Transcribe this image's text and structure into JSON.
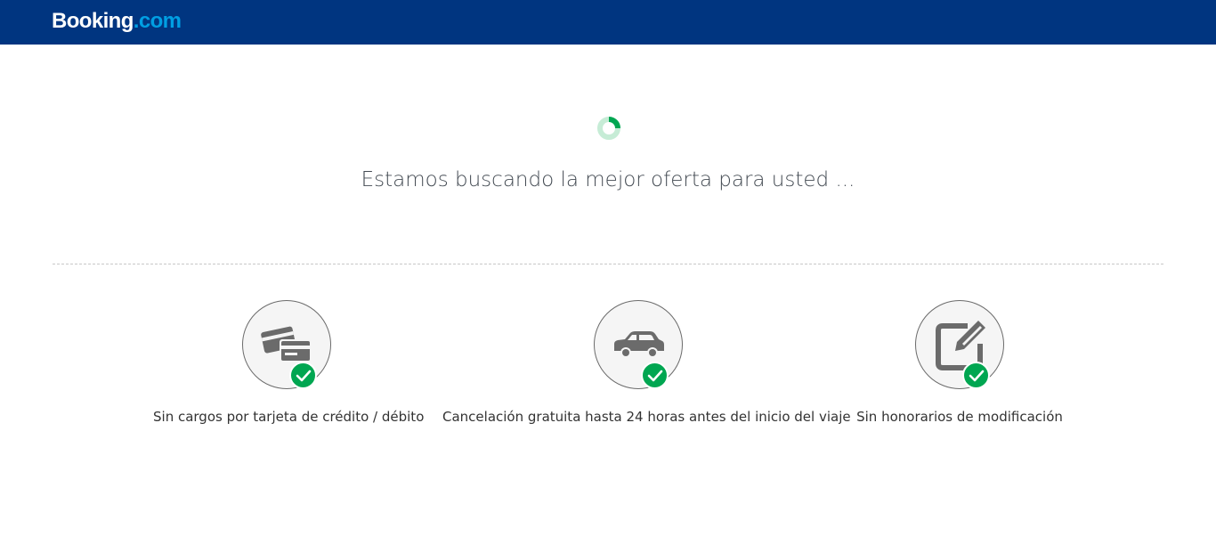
{
  "header": {
    "logo_main": "Booking",
    "logo_tld": ".com"
  },
  "loading": {
    "message": "Estamos buscando la mejor oferta para usted ..."
  },
  "features": [
    {
      "label": "Sin cargos por tarjeta de crédito / débito",
      "icon": "credit-cards-icon"
    },
    {
      "label": "Cancelación gratuita hasta 24 horas antes del inicio del viaje",
      "icon": "car-icon"
    },
    {
      "label": "Sin honorarios de modificación",
      "icon": "edit-icon"
    }
  ],
  "colors": {
    "header_bg": "#003580",
    "logo_tld": "#009fe3",
    "check_green": "#00a651",
    "spinner_green": "#00a651",
    "spinner_light": "#c6ecd6",
    "icon_gray": "#6b6b6b"
  }
}
